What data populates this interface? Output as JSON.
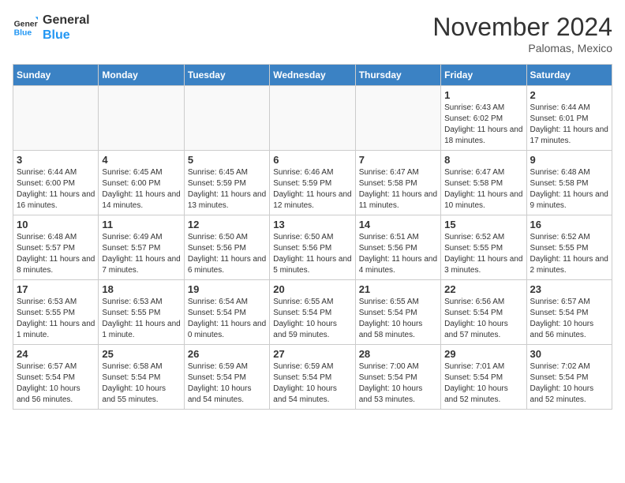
{
  "header": {
    "logo_line1": "General",
    "logo_line2": "Blue",
    "month": "November 2024",
    "location": "Palomas, Mexico"
  },
  "days_of_week": [
    "Sunday",
    "Monday",
    "Tuesday",
    "Wednesday",
    "Thursday",
    "Friday",
    "Saturday"
  ],
  "weeks": [
    [
      {
        "day": "",
        "empty": true
      },
      {
        "day": "",
        "empty": true
      },
      {
        "day": "",
        "empty": true
      },
      {
        "day": "",
        "empty": true
      },
      {
        "day": "",
        "empty": true
      },
      {
        "day": "1",
        "sunrise": "Sunrise: 6:43 AM",
        "sunset": "Sunset: 6:02 PM",
        "daylight": "Daylight: 11 hours and 18 minutes."
      },
      {
        "day": "2",
        "sunrise": "Sunrise: 6:44 AM",
        "sunset": "Sunset: 6:01 PM",
        "daylight": "Daylight: 11 hours and 17 minutes."
      }
    ],
    [
      {
        "day": "3",
        "sunrise": "Sunrise: 6:44 AM",
        "sunset": "Sunset: 6:00 PM",
        "daylight": "Daylight: 11 hours and 16 minutes."
      },
      {
        "day": "4",
        "sunrise": "Sunrise: 6:45 AM",
        "sunset": "Sunset: 6:00 PM",
        "daylight": "Daylight: 11 hours and 14 minutes."
      },
      {
        "day": "5",
        "sunrise": "Sunrise: 6:45 AM",
        "sunset": "Sunset: 5:59 PM",
        "daylight": "Daylight: 11 hours and 13 minutes."
      },
      {
        "day": "6",
        "sunrise": "Sunrise: 6:46 AM",
        "sunset": "Sunset: 5:59 PM",
        "daylight": "Daylight: 11 hours and 12 minutes."
      },
      {
        "day": "7",
        "sunrise": "Sunrise: 6:47 AM",
        "sunset": "Sunset: 5:58 PM",
        "daylight": "Daylight: 11 hours and 11 minutes."
      },
      {
        "day": "8",
        "sunrise": "Sunrise: 6:47 AM",
        "sunset": "Sunset: 5:58 PM",
        "daylight": "Daylight: 11 hours and 10 minutes."
      },
      {
        "day": "9",
        "sunrise": "Sunrise: 6:48 AM",
        "sunset": "Sunset: 5:58 PM",
        "daylight": "Daylight: 11 hours and 9 minutes."
      }
    ],
    [
      {
        "day": "10",
        "sunrise": "Sunrise: 6:48 AM",
        "sunset": "Sunset: 5:57 PM",
        "daylight": "Daylight: 11 hours and 8 minutes."
      },
      {
        "day": "11",
        "sunrise": "Sunrise: 6:49 AM",
        "sunset": "Sunset: 5:57 PM",
        "daylight": "Daylight: 11 hours and 7 minutes."
      },
      {
        "day": "12",
        "sunrise": "Sunrise: 6:50 AM",
        "sunset": "Sunset: 5:56 PM",
        "daylight": "Daylight: 11 hours and 6 minutes."
      },
      {
        "day": "13",
        "sunrise": "Sunrise: 6:50 AM",
        "sunset": "Sunset: 5:56 PM",
        "daylight": "Daylight: 11 hours and 5 minutes."
      },
      {
        "day": "14",
        "sunrise": "Sunrise: 6:51 AM",
        "sunset": "Sunset: 5:56 PM",
        "daylight": "Daylight: 11 hours and 4 minutes."
      },
      {
        "day": "15",
        "sunrise": "Sunrise: 6:52 AM",
        "sunset": "Sunset: 5:55 PM",
        "daylight": "Daylight: 11 hours and 3 minutes."
      },
      {
        "day": "16",
        "sunrise": "Sunrise: 6:52 AM",
        "sunset": "Sunset: 5:55 PM",
        "daylight": "Daylight: 11 hours and 2 minutes."
      }
    ],
    [
      {
        "day": "17",
        "sunrise": "Sunrise: 6:53 AM",
        "sunset": "Sunset: 5:55 PM",
        "daylight": "Daylight: 11 hours and 1 minute."
      },
      {
        "day": "18",
        "sunrise": "Sunrise: 6:53 AM",
        "sunset": "Sunset: 5:55 PM",
        "daylight": "Daylight: 11 hours and 1 minute."
      },
      {
        "day": "19",
        "sunrise": "Sunrise: 6:54 AM",
        "sunset": "Sunset: 5:54 PM",
        "daylight": "Daylight: 11 hours and 0 minutes."
      },
      {
        "day": "20",
        "sunrise": "Sunrise: 6:55 AM",
        "sunset": "Sunset: 5:54 PM",
        "daylight": "Daylight: 10 hours and 59 minutes."
      },
      {
        "day": "21",
        "sunrise": "Sunrise: 6:55 AM",
        "sunset": "Sunset: 5:54 PM",
        "daylight": "Daylight: 10 hours and 58 minutes."
      },
      {
        "day": "22",
        "sunrise": "Sunrise: 6:56 AM",
        "sunset": "Sunset: 5:54 PM",
        "daylight": "Daylight: 10 hours and 57 minutes."
      },
      {
        "day": "23",
        "sunrise": "Sunrise: 6:57 AM",
        "sunset": "Sunset: 5:54 PM",
        "daylight": "Daylight: 10 hours and 56 minutes."
      }
    ],
    [
      {
        "day": "24",
        "sunrise": "Sunrise: 6:57 AM",
        "sunset": "Sunset: 5:54 PM",
        "daylight": "Daylight: 10 hours and 56 minutes."
      },
      {
        "day": "25",
        "sunrise": "Sunrise: 6:58 AM",
        "sunset": "Sunset: 5:54 PM",
        "daylight": "Daylight: 10 hours and 55 minutes."
      },
      {
        "day": "26",
        "sunrise": "Sunrise: 6:59 AM",
        "sunset": "Sunset: 5:54 PM",
        "daylight": "Daylight: 10 hours and 54 minutes."
      },
      {
        "day": "27",
        "sunrise": "Sunrise: 6:59 AM",
        "sunset": "Sunset: 5:54 PM",
        "daylight": "Daylight: 10 hours and 54 minutes."
      },
      {
        "day": "28",
        "sunrise": "Sunrise: 7:00 AM",
        "sunset": "Sunset: 5:54 PM",
        "daylight": "Daylight: 10 hours and 53 minutes."
      },
      {
        "day": "29",
        "sunrise": "Sunrise: 7:01 AM",
        "sunset": "Sunset: 5:54 PM",
        "daylight": "Daylight: 10 hours and 52 minutes."
      },
      {
        "day": "30",
        "sunrise": "Sunrise: 7:02 AM",
        "sunset": "Sunset: 5:54 PM",
        "daylight": "Daylight: 10 hours and 52 minutes."
      }
    ]
  ]
}
